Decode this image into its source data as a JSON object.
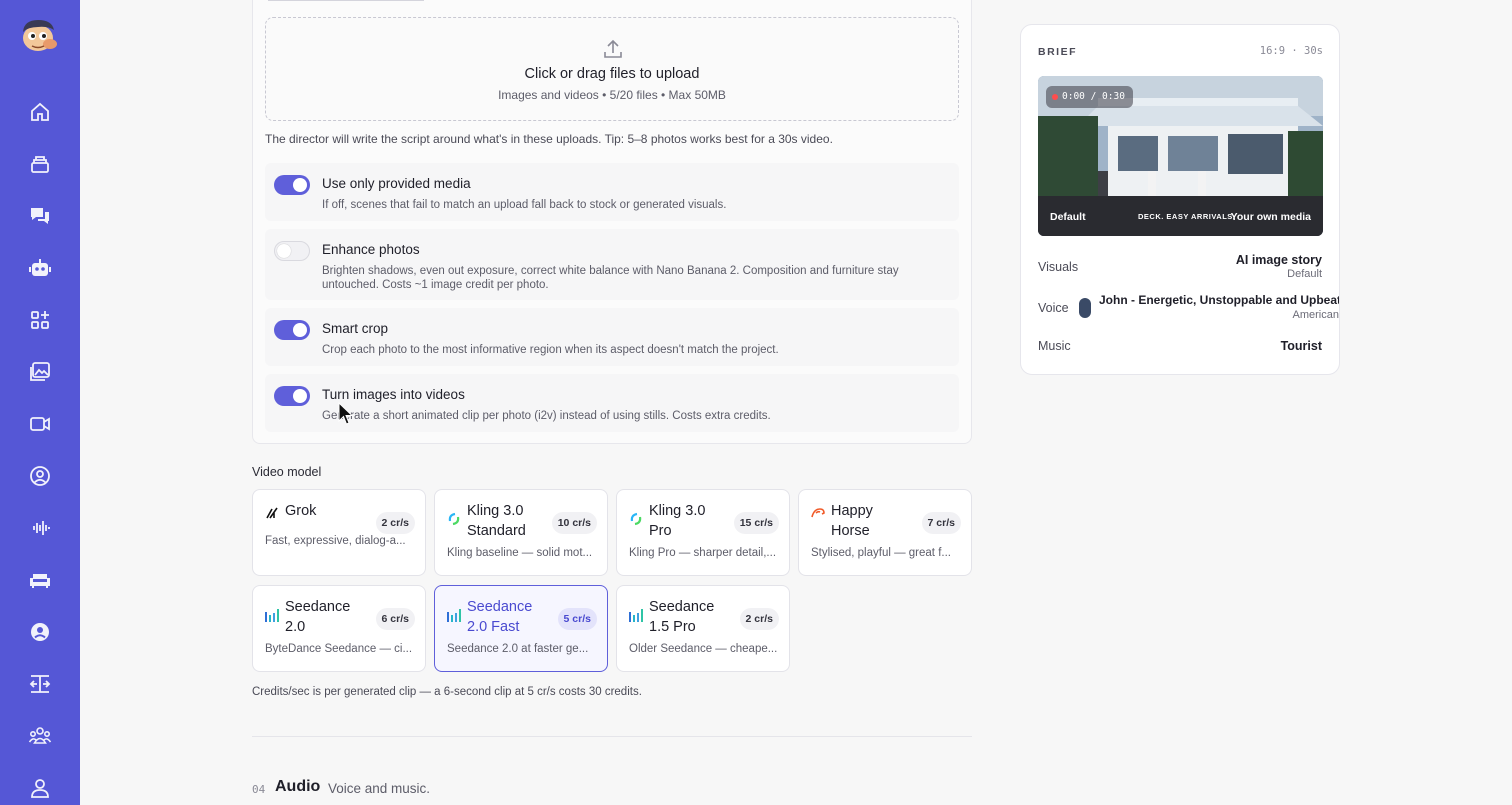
{
  "sidebar": {
    "icons": [
      "house-icon",
      "stack-icon",
      "chat-icon",
      "robot-icon",
      "apps-icon",
      "gallery-icon",
      "video-camera-icon",
      "user-circle-icon",
      "waveform-icon",
      "sofa-icon",
      "profile-icon",
      "dual-arrow-icon",
      "team-icon",
      "person-icon"
    ]
  },
  "upload": {
    "title": "Click or drag files to upload",
    "subtitle": "Images and videos • 5/20 files • Max 50MB",
    "tip": "The director will write the script around what's in these uploads. Tip: 5–8 photos works best for a 30s video."
  },
  "options": [
    {
      "title": "Use only provided media",
      "desc": "If off, scenes that fail to match an upload fall back to stock or generated visuals.",
      "on": true
    },
    {
      "title": "Enhance photos",
      "desc": "Brighten shadows, even out exposure, correct white balance with Nano Banana 2. Composition and furniture stay untouched. Costs ~1 image credit per photo.",
      "on": false
    },
    {
      "title": "Smart crop",
      "desc": "Crop each photo to the most informative region when its aspect doesn't match the project.",
      "on": true
    },
    {
      "title": "Turn images into videos",
      "desc": "Generate a short animated clip per photo (i2v) instead of using stills. Costs extra credits.",
      "on": true
    }
  ],
  "video_model": {
    "label": "Video model",
    "models": [
      {
        "name": "Grok",
        "rate": "2 cr/s",
        "desc": "Fast, expressive, dialog-a..."
      },
      {
        "name": "Kling 3.0 Standard",
        "rate": "10 cr/s",
        "desc": "Kling baseline — solid mot..."
      },
      {
        "name": "Kling 3.0 Pro",
        "rate": "15 cr/s",
        "desc": "Kling Pro — sharper detail,..."
      },
      {
        "name": "Happy Horse",
        "rate": "7 cr/s",
        "desc": "Stylised, playful — great f..."
      },
      {
        "name": "Seedance 2.0",
        "rate": "6 cr/s",
        "desc": "ByteDance Seedance — ci..."
      },
      {
        "name": "Seedance 2.0 Fast",
        "rate": "5 cr/s",
        "desc": "Seedance 2.0 at faster ge..."
      },
      {
        "name": "Seedance 1.5 Pro",
        "rate": "2 cr/s",
        "desc": "Older Seedance — cheape..."
      }
    ],
    "selected": "Seedance 2.0 Fast",
    "note": "Credits/sec is per generated clip — a 6-second clip at 5 cr/s costs 30 credits."
  },
  "audio": {
    "number": "04",
    "title": "Audio",
    "subtitle": "Voice and music."
  },
  "brief": {
    "title": "BRIEF",
    "format": "16:9 · 30s",
    "timecode": "0:00 / 0:30",
    "preview_left": "Default",
    "preview_mid": "DECK. EASY ARRIVALS.",
    "preview_right": "Your own media",
    "visuals_label": "Visuals",
    "visuals_value": "AI image story",
    "visuals_sub": "Default",
    "voice_label": "Voice",
    "voice_value": "John - Energetic, Unstoppable and Upbeat",
    "voice_sub": "American",
    "music_label": "Music",
    "music_value": "Tourist"
  },
  "colors": {
    "accent": "#5f5fda",
    "sidebar": "#5557d6"
  }
}
